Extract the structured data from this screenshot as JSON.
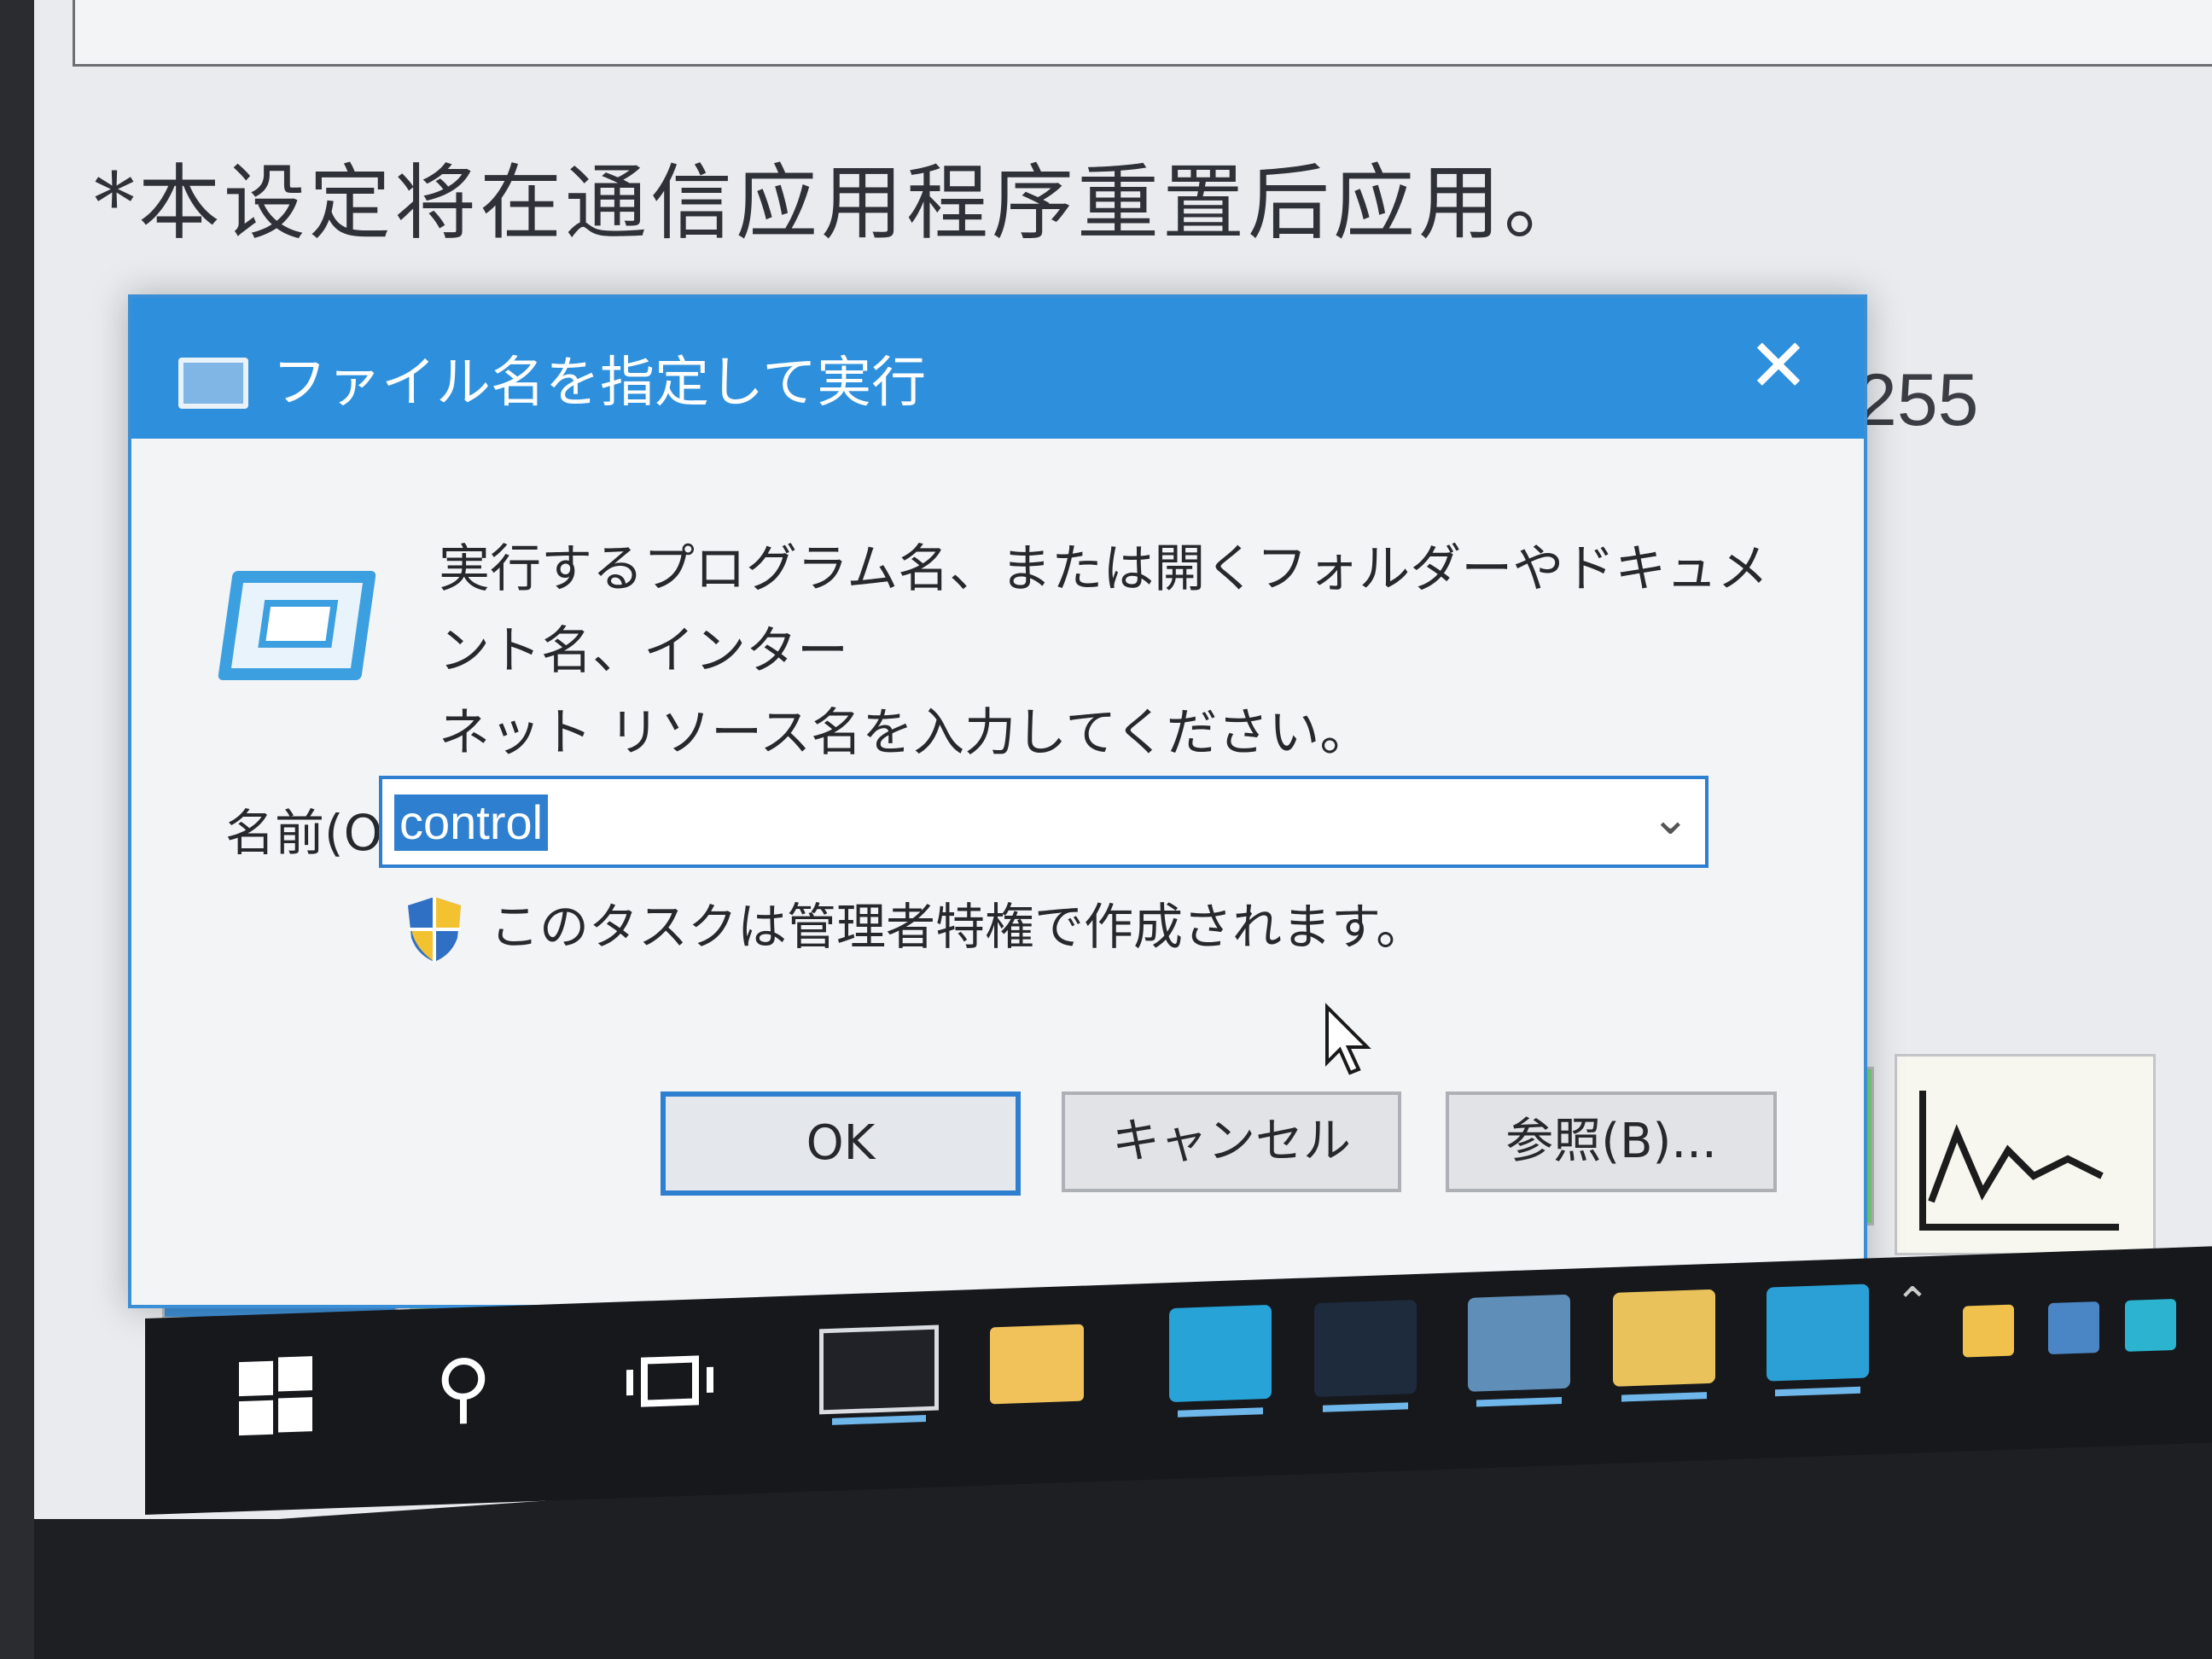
{
  "background_window": {
    "note": "*本设定将在通信应用程序重置后应用。",
    "partial_value": "255"
  },
  "dialog": {
    "title": "ファイル名を指定して実行",
    "close_glyph": "✕",
    "prompt_line1": "実行するプログラム名、または開くフォルダーやドキュメント名、インター",
    "prompt_line2": "ネット リソース名を入力してください。",
    "name_label": "名前(O):",
    "name_value": "control",
    "dropdown_glyph": "⌄",
    "admin_note": "このタスクは管理者特権で作成されます。",
    "buttons": {
      "ok": "OK",
      "cancel": "キャンセル",
      "browse": "参照(B)..."
    }
  },
  "taskbar": {
    "search_glyph": "⚲",
    "tray_chevron": "⌃"
  },
  "colors": {
    "titlebar": "#2e8fdc",
    "selection": "#2f7fd0",
    "taskbar": "#16181c"
  }
}
